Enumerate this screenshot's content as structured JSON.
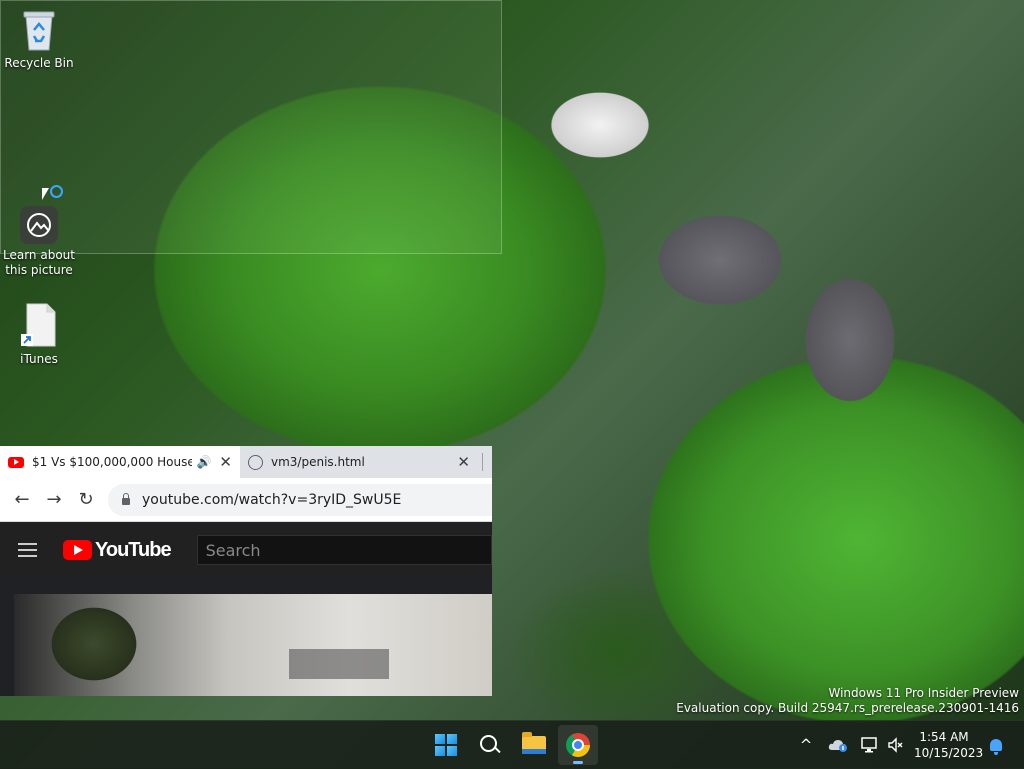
{
  "desktop": {
    "icons": [
      {
        "label": "Recycle Bin",
        "icon": "recycle-bin-icon"
      },
      {
        "label": "Learn about this picture",
        "icon": "learn-picture-icon"
      },
      {
        "label": "iTunes",
        "icon": "file-shortcut-icon"
      }
    ]
  },
  "browser": {
    "tabs": [
      {
        "title": "$1 Vs $100,000,000 House! -",
        "icon": "youtube-favicon",
        "audio": "🔊",
        "close": "✕"
      },
      {
        "title": "vm3/penis.html",
        "icon": "globe-icon",
        "close": "✕"
      }
    ],
    "url": "youtube.com/watch?v=3ryID_SwU5E",
    "nav": {
      "back": "←",
      "forward": "→",
      "reload": "↻"
    },
    "youtube": {
      "logo_text": "YouTube",
      "search_placeholder": "Search"
    }
  },
  "watermark": {
    "line1": "Windows 11 Pro Insider Preview",
    "line2": "Evaluation copy. Build 25947.rs_prerelease.230901-1416"
  },
  "taskbar": {
    "apps": [
      "start-icon",
      "search-icon",
      "file-explorer-icon",
      "chrome-icon"
    ],
    "tray": {
      "chevron": "^"
    },
    "clock": {
      "time": "1:54 AM",
      "date": "10/15/2023"
    }
  },
  "colors": {
    "accent": "#3aa7ff",
    "youtube_red": "#ff0000"
  }
}
